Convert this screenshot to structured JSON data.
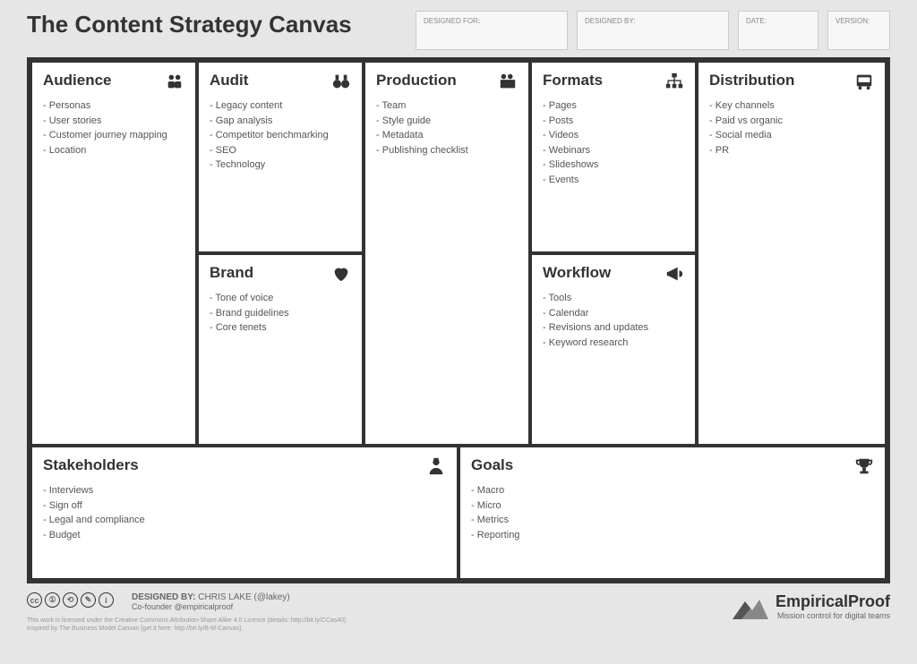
{
  "title": "The Content Strategy Canvas",
  "meta": {
    "designed_for_label": "DESIGNED FOR:",
    "designed_by_label": "DESIGNED BY:",
    "date_label": "DATE:",
    "version_label": "VERSION:"
  },
  "cells": {
    "audience": {
      "title": "Audience",
      "items": [
        "Personas",
        "User stories",
        "Customer journey mapping",
        "Location"
      ]
    },
    "audit": {
      "title": "Audit",
      "items": [
        "Legacy content",
        "Gap analysis",
        "Competitor benchmarking",
        "SEO",
        "Technology"
      ]
    },
    "brand": {
      "title": "Brand",
      "items": [
        "Tone of voice",
        "Brand guidelines",
        "Core tenets"
      ]
    },
    "production": {
      "title": "Production",
      "items": [
        "Team",
        "Style guide",
        "Metadata",
        "Publishing checklist"
      ]
    },
    "formats": {
      "title": "Formats",
      "items": [
        "Pages",
        "Posts",
        "Videos",
        "Webinars",
        "Slideshows",
        "Events"
      ]
    },
    "workflow": {
      "title": "Workflow",
      "items": [
        "Tools",
        "Calendar",
        "Revisions and updates",
        "Keyword research"
      ]
    },
    "distribution": {
      "title": "Distribution",
      "items": [
        "Key channels",
        "Paid vs organic",
        "Social media",
        "PR"
      ]
    },
    "stakeholders": {
      "title": "Stakeholders",
      "items": [
        "Interviews",
        "Sign off",
        "Legal and compliance",
        "Budget"
      ]
    },
    "goals": {
      "title": "Goals",
      "items": [
        "Macro",
        "Micro",
        "Metrics",
        "Reporting"
      ]
    }
  },
  "footer": {
    "designed_by_html": "DESIGNED BY: CHRIS LAKE (@lakey)",
    "designed_by_prefix": "DESIGNED BY:",
    "designed_by_name": "CHRIS LAKE (@lakey)",
    "cofounder": "Co-founder @empiricalproof",
    "fineprint1": "This work is licensed under the Creative Commons Attribution-Share Alike 4.0 Licence (details: http://bit.ly/CCas40).",
    "fineprint2": "Inspired by The Business Model Canvas (get it here: http://bit.ly/B-M-Canvas).",
    "brand_name": "EmpiricalProof",
    "brand_tag": "Mission control for digital teams"
  }
}
